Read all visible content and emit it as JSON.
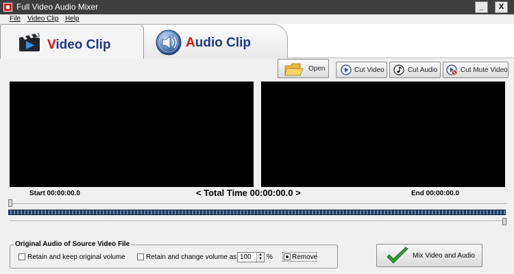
{
  "window": {
    "title": "Full Video Audio Mixer",
    "minimize_label": "_",
    "close_label": "X"
  },
  "menu": {
    "items": [
      "File",
      "Video Clip",
      "Help"
    ]
  },
  "tabs": {
    "video": {
      "first": "V",
      "rest": "ideo Clip"
    },
    "audio": {
      "first": "A",
      "rest": "udio Clip"
    }
  },
  "toolbar": {
    "open_label": "Open",
    "cut_video_label": "Cut Video",
    "cut_audio_label": "Cut Audio",
    "cut_mute_label": "Cut Mute Video"
  },
  "timeline": {
    "start_label": "Start 00:00:00.0",
    "total_label": "< Total Time 00:00:00.0 >",
    "end_label": "End 00:00:00.0"
  },
  "audio_options": {
    "group_title": "Original Audio of Source Video File",
    "retain_keep_label": "Retain and keep original volume",
    "retain_keep_checked": false,
    "retain_change_label": "Retain and change volume as",
    "retain_change_checked": false,
    "volume_value": "100",
    "percent_label": "%",
    "remove_label": "Remove",
    "remove_selected": true
  },
  "mix_button": {
    "label": "Mix Video and Audio"
  },
  "colors": {
    "titlebar": "#3e3e3e",
    "tab_text": "#1f3a8a",
    "tab_initial": "#d11111",
    "filmstrip": "#1e3e64",
    "checkmark": "#2e9e2e"
  }
}
